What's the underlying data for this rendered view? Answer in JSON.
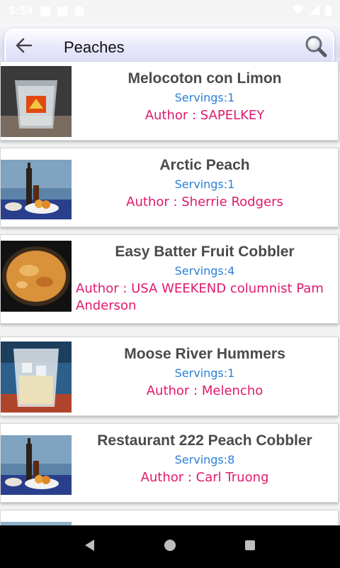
{
  "status_bar": {
    "time": "5:54"
  },
  "search": {
    "query": "Peaches"
  },
  "recipes": [
    {
      "title": "Melocoton con Limon",
      "servings": "Servings:1",
      "author": "Author : SAPELKEY"
    },
    {
      "title": "Arctic Peach",
      "servings": "Servings:1",
      "author": "Author : Sherrie Rodgers"
    },
    {
      "title": "Easy Batter Fruit Cobbler",
      "servings": "Servings:4",
      "author": "Author : USA WEEKEND columnist Pam Anderson"
    },
    {
      "title": "Moose River Hummers",
      "servings": "Servings:1",
      "author": "Author : Melencho"
    },
    {
      "title": "Restaurant 222 Peach Cobbler",
      "servings": "Servings:8",
      "author": "Author : Carl Truong"
    }
  ],
  "colors": {
    "title": "#4a4a4a",
    "servings": "#2b7fd6",
    "author": "#e0196d"
  },
  "icons": {
    "back": "arrow-left-icon",
    "search": "magnifier-icon",
    "nav_back": "triangle-back-icon",
    "nav_home": "circle-home-icon",
    "nav_recents": "square-recents-icon"
  }
}
